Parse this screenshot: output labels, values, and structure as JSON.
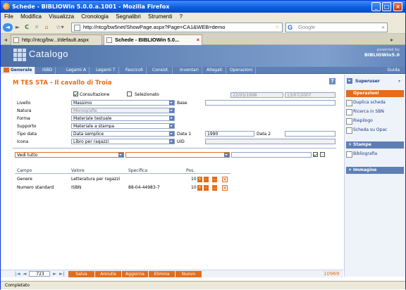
{
  "window": {
    "title": "Schede - BIBLIOWin 5.0.0.a.1001 - Mozilla Firefox",
    "controls": {
      "minimize": "_",
      "maximize": "□",
      "close": "×"
    }
  },
  "menu": [
    "File",
    "Modifica",
    "Visualizza",
    "Cronologia",
    "Segnalibri",
    "Strumenti",
    "?"
  ],
  "nav": {
    "url": "http://ntcg/bw5net/ShowPage.aspx?Page=CA1&WEB=demo",
    "search_placeholder": "Google",
    "search_engine": "G"
  },
  "browser_tabs": [
    {
      "label": "http://ntcg/bw...t/default.aspx",
      "active": false
    },
    {
      "label": "Schede - BIBLIOWin 5.0...",
      "active": true
    }
  ],
  "banner": {
    "app": "Catalogo",
    "powered": "powered by",
    "product": "BIBLIOWin5.0"
  },
  "main_tabs": [
    "Generale",
    "ISBD",
    "Legami A",
    "Legami T",
    "Fascicoli",
    "Consist.",
    "Inventari",
    "Allegati",
    "Operazioni"
  ],
  "help_tab": "Guida",
  "record": {
    "title": "M TES STA - Il cavallo di Troia",
    "help": "?"
  },
  "form": {
    "consultazione": "Consultazione",
    "selezionato": "Selezionato",
    "date_1": "22/05/1998",
    "date_2": "13/07/2007",
    "livello_label": "Livello",
    "livello_value": "Massimo",
    "base_label": "Base",
    "natura_label": "Natura",
    "natura_value": "Monografie",
    "forma_label": "Forma",
    "forma_value": "Materiale testuale",
    "supporto_label": "Supporto",
    "supporto_value": "Materiale a stampa",
    "tipo_data_label": "Tipo data",
    "tipo_data_value": "Data semplice",
    "data1_label": "Data 1",
    "data1_value": "1990",
    "data2_label": "Data 2",
    "icona_label": "Icona",
    "icona_value": "Libro per ragazzi",
    "uid_label": "UID",
    "filter_value": "Vedi tutto"
  },
  "table": {
    "headers": [
      "Campo",
      "Valore",
      "Specifica",
      "Pos."
    ],
    "rows": [
      {
        "campo": "Genere",
        "valore": "Letteratura per ragazzi",
        "specifica": "",
        "pos": "10"
      },
      {
        "campo": "Numero standard",
        "valore": "ISBN",
        "specifica": "88-04-44983-7",
        "pos": "10"
      }
    ],
    "row_buttons": [
      "+",
      "-",
      "...",
      "×"
    ]
  },
  "footer": {
    "nav_first": "|◄",
    "nav_prev": "◄",
    "record_no": "723",
    "nav_next": "►",
    "nav_last": "►|",
    "buttons": [
      "Salva",
      "Annulla",
      "Aggiorna",
      "Elimina",
      "Nuovo"
    ],
    "total": "10969"
  },
  "right_panel": {
    "user": "Superuser",
    "operazioni_title": "Operazioni",
    "operazioni": [
      "Duplica scheda",
      "Ricerca in SBN",
      "Riepilogo",
      "Scheda su Opac"
    ],
    "stampe_title": "Stampe",
    "bibliografia": "Bibliografia",
    "immagine_title": "Immagine"
  },
  "status": {
    "text": "Completato"
  }
}
